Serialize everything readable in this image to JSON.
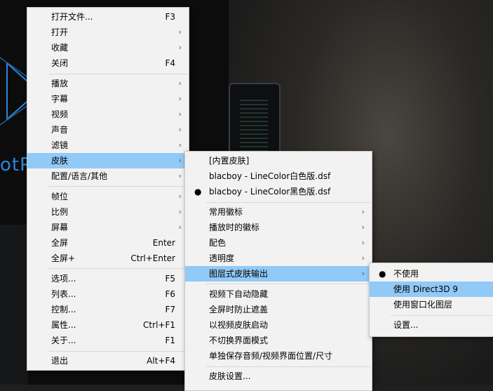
{
  "colors": {
    "menu_bg": "#f2f2f2",
    "highlight": "#91c9f7",
    "logo_blue": "#2b86d6"
  },
  "background": {
    "logo_text": "otP"
  },
  "main_menu": {
    "items": [
      {
        "label": "打开文件...",
        "shortcut": "F3"
      },
      {
        "label": "打开",
        "arrow": "›"
      },
      {
        "label": "收藏",
        "arrow": "›"
      },
      {
        "label": "关闭",
        "shortcut": "F4"
      },
      {
        "label": "播放",
        "arrow": "›"
      },
      {
        "label": "字幕",
        "arrow": "›"
      },
      {
        "label": "视频",
        "arrow": "›"
      },
      {
        "label": "声音",
        "arrow": "›"
      },
      {
        "label": "滤镜",
        "arrow": "›"
      },
      {
        "label": "皮肤",
        "arrow": "›"
      },
      {
        "label": "配置/语言/其他",
        "arrow": "›"
      },
      {
        "label": "帧位",
        "arrow": "›"
      },
      {
        "label": "比例",
        "arrow": "›"
      },
      {
        "label": "屏幕",
        "arrow": "›"
      },
      {
        "label": "全屏",
        "shortcut": "Enter"
      },
      {
        "label": "全屏+",
        "shortcut": "Ctrl+Enter"
      },
      {
        "label": "选项...",
        "shortcut": "F5"
      },
      {
        "label": "列表...",
        "shortcut": "F6"
      },
      {
        "label": "控制...",
        "shortcut": "F7"
      },
      {
        "label": "属性...",
        "shortcut": "Ctrl+F1"
      },
      {
        "label": "关于...",
        "shortcut": "F1"
      },
      {
        "label": "退出",
        "shortcut": "Alt+F4"
      }
    ]
  },
  "skin_menu": {
    "items": [
      {
        "label": "[内置皮肤]"
      },
      {
        "label": "blacboy - LineColor白色版.dsf"
      },
      {
        "label": "blacboy - LineColor黑色版.dsf",
        "bullet": "●"
      },
      {
        "label": "常用徽标",
        "arrow": "›"
      },
      {
        "label": "播放时的徽标",
        "arrow": "›"
      },
      {
        "label": "配色",
        "arrow": "›"
      },
      {
        "label": "透明度",
        "arrow": "›"
      },
      {
        "label": "图层式皮肤输出",
        "arrow": "›"
      },
      {
        "label": "视频下自动隐藏"
      },
      {
        "label": "全屏时防止遮盖"
      },
      {
        "label": "以视频皮肤启动"
      },
      {
        "label": "不切换界面模式"
      },
      {
        "label": "单独保存音频/视频界面位置/尺寸"
      },
      {
        "label": "皮肤设置..."
      }
    ]
  },
  "layer_menu": {
    "items": [
      {
        "label": "不使用",
        "bullet": "●"
      },
      {
        "label": "使用 Direct3D 9"
      },
      {
        "label": "使用窗口化图层"
      },
      {
        "label": "设置..."
      }
    ]
  }
}
